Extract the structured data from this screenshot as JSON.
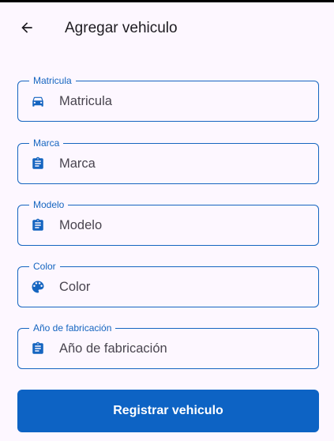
{
  "appbar": {
    "title": "Agregar vehiculo"
  },
  "fields": [
    {
      "label": "Matricula",
      "placeholder": "Matricula",
      "icon": "car-icon"
    },
    {
      "label": "Marca",
      "placeholder": "Marca",
      "icon": "clipboard-icon"
    },
    {
      "label": "Modelo",
      "placeholder": "Modelo",
      "icon": "clipboard-icon"
    },
    {
      "label": "Color",
      "placeholder": "Color",
      "icon": "palette-icon"
    },
    {
      "label": "Año de fabricación",
      "placeholder": "Año de fabricación",
      "icon": "clipboard-icon"
    }
  ],
  "submit": {
    "label": "Registrar vehiculo"
  },
  "colors": {
    "primary": "#1565c0",
    "button": "#0d63c4",
    "background": "#fdf7ff"
  }
}
